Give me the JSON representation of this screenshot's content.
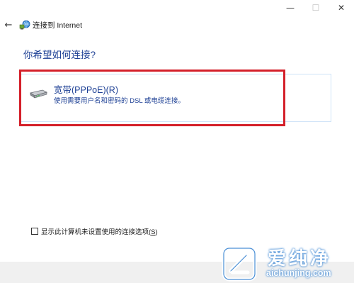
{
  "window": {
    "title": "连接到 Internet",
    "minimize_glyph": "—",
    "maximize_glyph": "☐",
    "close_glyph": "✕"
  },
  "nav": {
    "back_glyph": "←"
  },
  "main": {
    "heading": "你希望如何连接?",
    "options": [
      {
        "title": "宽带(PPPoE)(R)",
        "description": "使用需要用户名和密码的 DSL 或电缆连接。",
        "icon": "broadband-modem-icon"
      }
    ]
  },
  "checkbox": {
    "label_prefix": "显示此计算机未设置使用的连接选项(",
    "label_mnemonic": "S",
    "label_suffix": ")",
    "checked": false
  },
  "watermark": {
    "brand": "爱纯净",
    "url": "aichunjing.com"
  },
  "colors": {
    "heading": "#1c3f94",
    "highlight": "#d4202a",
    "panel_border": "#cfe3f7"
  }
}
